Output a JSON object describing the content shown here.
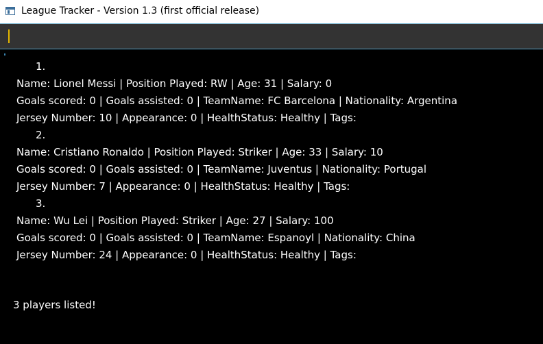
{
  "window": {
    "title": "League Tracker - Version 1.3 (first official release)"
  },
  "input": {
    "value": ""
  },
  "players": [
    {
      "number": "1.",
      "line1": "Name: Lionel Messi  |  Position Played: RW  |  Age: 31  |  Salary: 0",
      "line2": "Goals scored: 0  |  Goals assisted: 0  |  TeamName: FC Barcelona  |  Nationality: Argentina",
      "line3": "Jersey Number: 10  |  Appearance: 0  |  HealthStatus: Healthy | Tags:"
    },
    {
      "number": "2.",
      "line1": "Name: Cristiano Ronaldo  |  Position Played: Striker  |  Age: 33  |  Salary: 10",
      "line2": "Goals scored: 0  |  Goals assisted: 0  |  TeamName: Juventus  |  Nationality: Portugal",
      "line3": "Jersey Number: 7  |  Appearance: 0  |  HealthStatus: Healthy | Tags:"
    },
    {
      "number": "3.",
      "line1": "Name: Wu Lei  |  Position Played: Striker  |  Age: 27  |  Salary: 100",
      "line2": "Goals scored: 0  |  Goals assisted: 0  |  TeamName: Espanoyl  |  Nationality: China",
      "line3": "Jersey Number: 24  |  Appearance: 0  |  HealthStatus: Healthy | Tags:"
    }
  ],
  "summary": "3 players listed!",
  "colors": {
    "background": "#000000",
    "input_bg": "#333333",
    "caret": "#e6b800",
    "accent": "#5aa8cc",
    "text": "#ffffff"
  },
  "icons": {
    "app": "window-app-icon"
  }
}
